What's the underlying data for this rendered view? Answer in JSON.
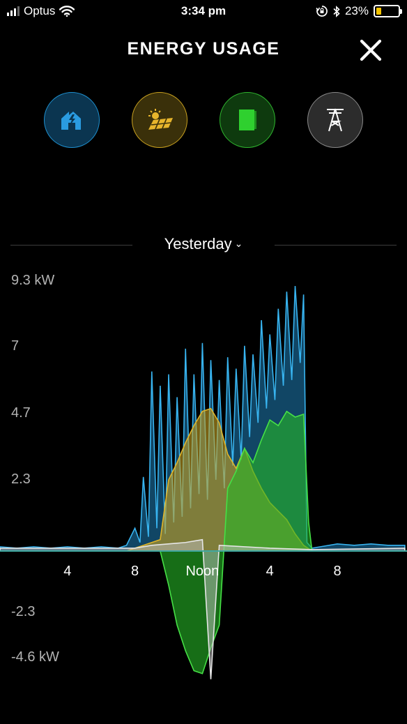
{
  "status_bar": {
    "carrier": "Optus",
    "time": "3:34 pm",
    "battery_percent": "23%",
    "battery_level": 0.23,
    "icons": [
      "signal-icon",
      "wifi-icon",
      "orientation-lock-icon",
      "bluetooth-icon",
      "battery-icon"
    ]
  },
  "header": {
    "title": "ENERGY USAGE",
    "close_icon": "close-icon"
  },
  "sources": [
    {
      "name": "home",
      "icon": "home-icon",
      "color": "#1e90d0"
    },
    {
      "name": "solar",
      "icon": "solar-panel-icon",
      "color": "#e0b52a"
    },
    {
      "name": "powerwall",
      "icon": "battery-icon",
      "color": "#2fd02f"
    },
    {
      "name": "grid",
      "icon": "power-tower-icon",
      "color": "#cccccc"
    }
  ],
  "period": {
    "label": "Yesterday",
    "chevron": "chevron-down-icon"
  },
  "chart_data": {
    "type": "area",
    "y_ticks": [
      "9.3 kW",
      "7",
      "4.7",
      "2.3",
      "-2.3",
      "-4.6 kW"
    ],
    "x_ticks": [
      "4",
      "8",
      "Noon",
      "4",
      "8"
    ],
    "ylim": [
      -4.6,
      9.3
    ],
    "xlim": [
      0,
      24
    ],
    "colors": {
      "home": "#29a3e0",
      "solar": "#e0b52a",
      "powerwall": "#2fd02f",
      "grid": "#d8d8d8"
    },
    "series": [
      {
        "key": "home",
        "x": [
          0,
          1,
          2,
          3,
          4,
          5,
          6,
          7,
          7.5,
          8,
          8.3,
          8.5,
          8.8,
          9,
          9.3,
          9.5,
          9.8,
          10,
          10.3,
          10.5,
          10.8,
          11,
          11.3,
          11.5,
          11.8,
          12,
          12.3,
          12.5,
          12.8,
          13,
          13.3,
          13.5,
          13.8,
          14,
          14.3,
          14.5,
          14.8,
          15,
          15.3,
          15.5,
          15.8,
          16,
          16.3,
          16.5,
          16.8,
          17,
          17.3,
          17.5,
          17.8,
          18,
          18.2,
          18.5,
          19,
          20,
          21,
          22,
          23,
          24
        ],
        "values": [
          0.15,
          0.1,
          0.15,
          0.1,
          0.15,
          0.1,
          0.15,
          0.1,
          0.2,
          0.8,
          0.3,
          2.6,
          0.5,
          6.3,
          0.8,
          5.8,
          0.6,
          6.2,
          1.0,
          5.4,
          1.2,
          7.1,
          1.5,
          6.2,
          2.0,
          7.3,
          1.8,
          6.7,
          2.5,
          6.0,
          2.2,
          6.8,
          3.0,
          6.4,
          3.2,
          7.2,
          4.0,
          6.9,
          4.5,
          8.1,
          5.0,
          7.6,
          5.3,
          8.5,
          5.8,
          9.1,
          6.0,
          9.3,
          6.6,
          9.0,
          0.3,
          0.1,
          0.15,
          0.25,
          0.2,
          0.25,
          0.2,
          0.2
        ]
      },
      {
        "key": "solar",
        "x": [
          7.5,
          8,
          8.5,
          9,
          9.5,
          10,
          10.5,
          11,
          11.5,
          12,
          12.5,
          13,
          13.5,
          14,
          14.5,
          15,
          15.5,
          16,
          16.5,
          17,
          17.5,
          18,
          18.5
        ],
        "values": [
          0,
          0.1,
          0.2,
          0.3,
          0.4,
          2.5,
          3.1,
          3.8,
          4.4,
          4.9,
          5.0,
          4.5,
          3.4,
          2.9,
          3.6,
          2.8,
          2.2,
          1.7,
          1.4,
          1.1,
          0.6,
          0.2,
          0
        ]
      },
      {
        "key": "powerwall",
        "x": [
          9.5,
          10,
          10.5,
          11,
          11.5,
          12,
          12.5,
          13,
          13.5,
          14,
          14.5,
          15,
          15.5,
          16,
          16.5,
          17,
          17.5,
          18,
          18.3,
          18.5
        ],
        "values": [
          0,
          -1.2,
          -2.6,
          -3.5,
          -4.2,
          -4.3,
          -3.4,
          -2.6,
          2.2,
          2.8,
          3.6,
          3.1,
          3.9,
          4.6,
          4.4,
          4.9,
          4.7,
          4.8,
          1.0,
          0
        ],
        "min": -4.3,
        "max": 4.9
      },
      {
        "key": "grid",
        "x": [
          0,
          8,
          9,
          11,
          12,
          12.5,
          13,
          16,
          18.5,
          24
        ],
        "values": [
          0.1,
          0.1,
          0.2,
          0.3,
          0.4,
          -4.5,
          0.2,
          0.1,
          0.05,
          0.1
        ]
      }
    ]
  }
}
